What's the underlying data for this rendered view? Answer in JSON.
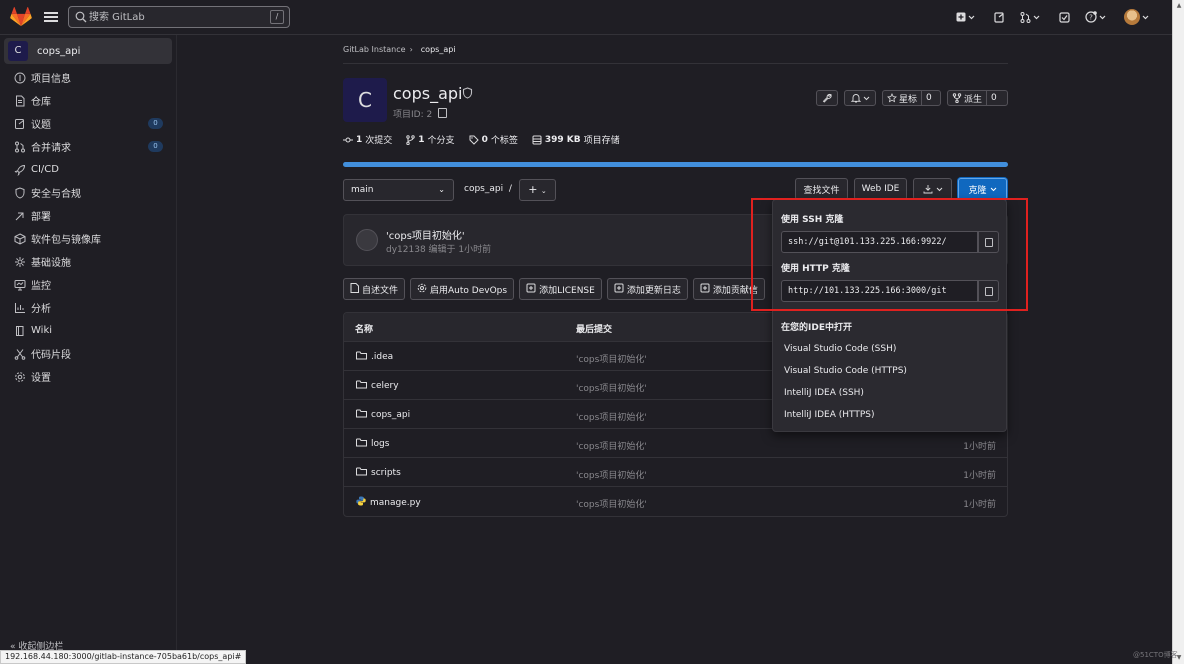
{
  "topbar": {
    "search_placeholder": "搜索 GitLab",
    "search_shortcut": "/"
  },
  "sidebar": {
    "project_initial": "C",
    "project_name": "cops_api",
    "items": [
      {
        "label": "项目信息",
        "icon": "project-icon"
      },
      {
        "label": "仓库",
        "icon": "doc-icon"
      },
      {
        "label": "议题",
        "icon": "issues-icon",
        "badge": "0"
      },
      {
        "label": "合并请求",
        "icon": "merge-request-icon",
        "badge": "0"
      },
      {
        "label": "CI/CD",
        "icon": "rocket-icon"
      },
      {
        "label": "安全与合规",
        "icon": "shield-icon"
      },
      {
        "label": "部署",
        "icon": "deployments-icon"
      },
      {
        "label": "软件包与镜像库",
        "icon": "package-icon"
      },
      {
        "label": "基础设施",
        "icon": "cloud-icon"
      },
      {
        "label": "监控",
        "icon": "monitor-icon"
      },
      {
        "label": "分析",
        "icon": "chart-icon"
      },
      {
        "label": "Wiki",
        "icon": "book-icon"
      },
      {
        "label": "代码片段",
        "icon": "snippet-icon"
      },
      {
        "label": "设置",
        "icon": "settings-icon"
      }
    ],
    "collapse_label": "收起侧边栏"
  },
  "breadcrumb": {
    "root": "GitLab Instance",
    "sep": "›",
    "current": "cops_api"
  },
  "project": {
    "initial": "C",
    "title": "cops_api",
    "id_label": "项目ID: 2",
    "star_label": "星标",
    "star_count": "0",
    "fork_label": "派生",
    "fork_count": "0"
  },
  "stats": {
    "commits_num": "1",
    "commits_label": "次提交",
    "branches_num": "1",
    "branches_label": "个分支",
    "tags_num": "0",
    "tags_label": "个标签",
    "storage_num": "399 KB",
    "storage_label": "项目存储"
  },
  "language_bar": {
    "fill_fraction": 1.0,
    "color": "#428fdc"
  },
  "repo_toolbar": {
    "branch": "main",
    "path": "cops_api",
    "path_sep": "/",
    "add": "+",
    "find_file": "查找文件",
    "web_ide": "Web IDE",
    "clone": "克隆"
  },
  "commit": {
    "message": "'cops项目初始化'",
    "author": "dy12138",
    "meta": "编辑于 1小时前"
  },
  "actions": [
    "自述文件",
    "启用Auto DevOps",
    "添加LICENSE",
    "添加更新日志",
    "添加贡献信"
  ],
  "files": {
    "header_name": "名称",
    "header_commit": "最后提交",
    "rows": [
      {
        "name": ".idea",
        "type": "folder",
        "commit": "'cops项目初始化'",
        "time": ""
      },
      {
        "name": "celery",
        "type": "folder",
        "commit": "'cops项目初始化'",
        "time": ""
      },
      {
        "name": "cops_api",
        "type": "folder",
        "commit": "'cops项目初始化'",
        "time": ""
      },
      {
        "name": "logs",
        "type": "folder",
        "commit": "'cops项目初始化'",
        "time": "1小时前"
      },
      {
        "name": "scripts",
        "type": "folder",
        "commit": "'cops项目初始化'",
        "time": "1小时前"
      },
      {
        "name": "manage.py",
        "type": "python",
        "commit": "'cops项目初始化'",
        "time": "1小时前"
      }
    ]
  },
  "clone_dropdown": {
    "ssh_label": "使用 SSH 克隆",
    "ssh_url": "ssh://git@101.133.225.166:9922/",
    "http_label": "使用 HTTP 克隆",
    "http_url": "http://101.133.225.166:3000/git",
    "ide_header": "在您的IDE中打开",
    "ide_options": [
      "Visual Studio Code (SSH)",
      "Visual Studio Code (HTTPS)",
      "IntelliJ IDEA (SSH)",
      "IntelliJ IDEA (HTTPS)"
    ]
  },
  "status_url": "192.168.44.180:3000/gitlab-instance-705ba61b/cops_api#",
  "watermark": "@51CTO博客",
  "colors": {
    "accent": "#1068bf",
    "highlight_box": "#e0211f",
    "background": "#1f1e24"
  }
}
